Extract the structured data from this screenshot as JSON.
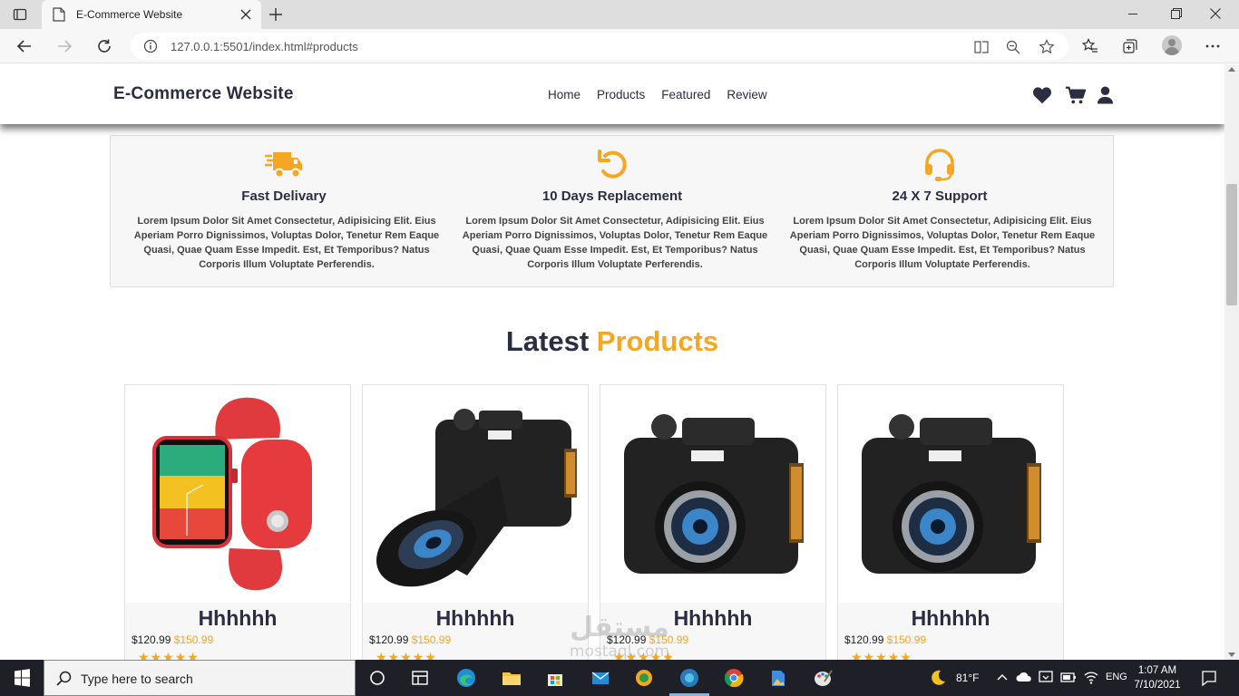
{
  "browser": {
    "tab_title": "E-Commerce Website",
    "url": "127.0.0.1:5501/index.html#products"
  },
  "site": {
    "logo": "E-Commerce Website",
    "nav": [
      "Home",
      "Products",
      "Featured",
      "Review"
    ],
    "header_icons": [
      "heart-icon",
      "cart-icon",
      "user-icon"
    ]
  },
  "features": [
    {
      "icon": "truck-icon",
      "title": "Fast Delivary",
      "text": "Lorem Ipsum Dolor Sit Amet Consectetur, Adipisicing Elit. Eius Aperiam Porro Dignissimos, Voluptas Dolor, Tenetur Rem Eaque Quasi, Quae Quam Esse Impedit. Est, Et Temporibus? Natus Corporis Illum Voluptate Perferendis."
    },
    {
      "icon": "refresh-icon",
      "title": "10 Days Replacement",
      "text": "Lorem Ipsum Dolor Sit Amet Consectetur, Adipisicing Elit. Eius Aperiam Porro Dignissimos, Voluptas Dolor, Tenetur Rem Eaque Quasi, Quae Quam Esse Impedit. Est, Et Temporibus? Natus Corporis Illum Voluptate Perferendis."
    },
    {
      "icon": "headset-icon",
      "title": "24 X 7 Support",
      "text": "Lorem Ipsum Dolor Sit Amet Consectetur, Adipisicing Elit. Eius Aperiam Porro Dignissimos, Voluptas Dolor, Tenetur Rem Eaque Quasi, Quae Quam Esse Impedit. Est, Et Temporibus? Natus Corporis Illum Voluptate Perferendis."
    }
  ],
  "section": {
    "title_part1": "Latest",
    "title_part2": "Products"
  },
  "products": [
    {
      "image": "smartwatch-image",
      "name": "Hhhhhh",
      "price": "$120.99",
      "old_price": "$150.99",
      "stars": 5
    },
    {
      "image": "dslr-camera-zoom-image",
      "name": "Hhhhhh",
      "price": "$120.99",
      "old_price": "$150.99",
      "stars": 5
    },
    {
      "image": "dslr-camera-image",
      "name": "Hhhhhh",
      "price": "$120.99",
      "old_price": "$150.99",
      "stars": 5
    },
    {
      "image": "dslr-camera-image",
      "name": "Hhhhhh",
      "price": "$120.99",
      "old_price": "$150.99",
      "stars": 5
    }
  ],
  "watermark": {
    "arabic": "مستقل",
    "latin": "mostaql.com"
  },
  "taskbar": {
    "search_placeholder": "Type here to search",
    "weather": "81°F",
    "language": "ENG",
    "time": "1:07 AM",
    "date": "7/10/2021"
  },
  "colors": {
    "accent": "#f5a623",
    "dark": "#2b2d42",
    "feature_bg": "#f7f7f7"
  }
}
